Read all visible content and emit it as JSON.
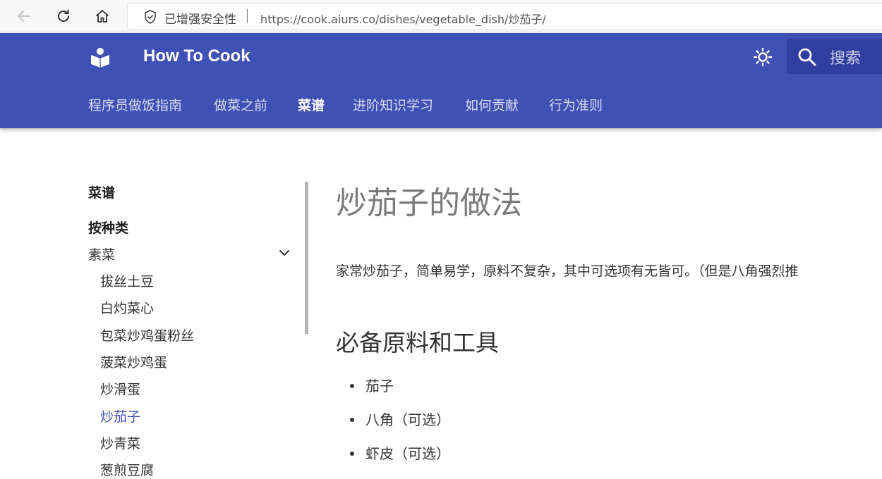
{
  "browser": {
    "security_label": "已增强安全性",
    "url": "https://cook.aiurs.co/dishes/vegetable_dish/炒茄子/"
  },
  "header": {
    "title": "How To Cook",
    "search_placeholder": "搜索",
    "accent_color": "#3f51b5",
    "search_bg_color": "#303f9f",
    "tabs": [
      {
        "label": "程序员做饭指南"
      },
      {
        "label": "做菜之前"
      },
      {
        "label": "菜谱"
      },
      {
        "label": "进阶知识学习"
      },
      {
        "label": "如何贡献"
      },
      {
        "label": "行为准则"
      }
    ],
    "active_tab": "菜谱"
  },
  "sidebar": {
    "title": "菜谱",
    "group": "按种类",
    "section": "素菜",
    "items": [
      {
        "label": "拔丝土豆"
      },
      {
        "label": "白灼菜心"
      },
      {
        "label": "包菜炒鸡蛋粉丝"
      },
      {
        "label": "菠菜炒鸡蛋"
      },
      {
        "label": "炒滑蛋"
      },
      {
        "label": "炒茄子"
      },
      {
        "label": "炒青菜"
      },
      {
        "label": "葱煎豆腐"
      }
    ],
    "active_item": "炒茄子"
  },
  "main": {
    "title": "炒茄子的做法",
    "intro": "家常炒茄子，简单易学，原料不复杂，其中可选项有无皆可。（但是八角强烈推",
    "section_heading": "必备原料和工具",
    "ingredients": [
      {
        "label": "茄子"
      },
      {
        "label": "八角（可选）"
      },
      {
        "label": "虾皮（可选）"
      }
    ]
  }
}
